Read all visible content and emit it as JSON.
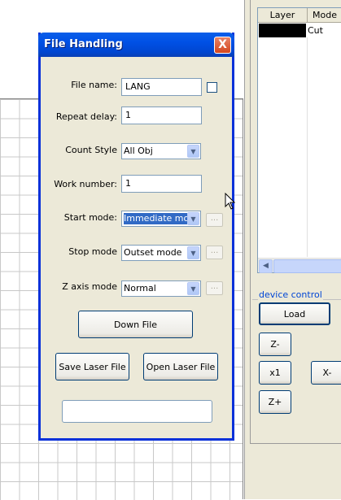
{
  "layer_table": {
    "headers": [
      "Layer",
      "Mode"
    ],
    "rows": [
      {
        "color": "#000000",
        "mode": "Cut"
      }
    ]
  },
  "device_control": {
    "label": "device control",
    "load": "Load",
    "z_minus": "Z-",
    "x1": "x1",
    "x_minus": "X-",
    "z_plus": "Z+"
  },
  "dialog": {
    "title": "File Handling",
    "close": "X",
    "file_name": {
      "label": "File name:",
      "value": "LANG"
    },
    "repeat_delay": {
      "label": "Repeat delay:",
      "value": "1"
    },
    "count_style": {
      "label": "Count Style",
      "value": "All Obj"
    },
    "work_number": {
      "label": "Work number:",
      "value": "1"
    },
    "start_mode": {
      "label": "Start mode:",
      "value": "Immediate mode"
    },
    "stop_mode": {
      "label": "Stop mode",
      "value": "Outset mode"
    },
    "z_axis_mode": {
      "label": "Z axis mode",
      "value": "Normal"
    },
    "ellipsis": "...",
    "down_file": "Down File",
    "save_laser_file": "Save Laser File",
    "open_laser_file": "Open Laser File",
    "status": ""
  }
}
